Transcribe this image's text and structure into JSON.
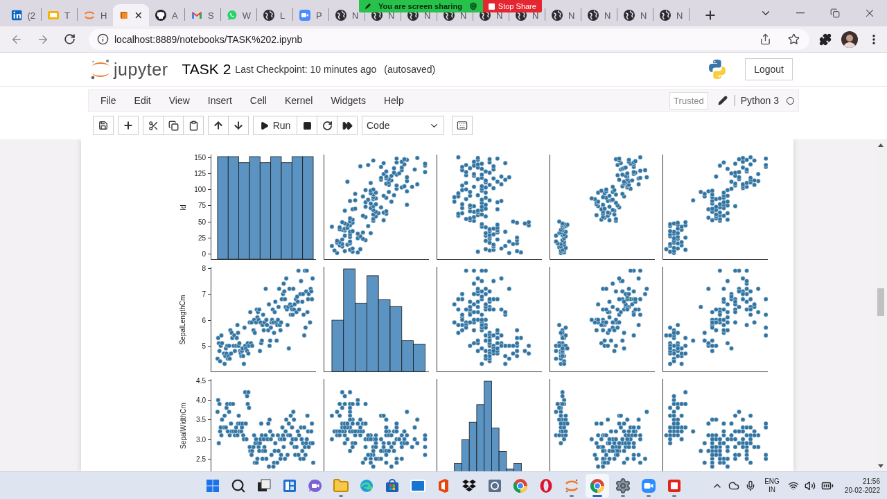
{
  "browser": {
    "tabs": [
      {
        "kind": "linkedin",
        "label": "(2",
        "selected": false
      },
      {
        "kind": "slides",
        "label": "T",
        "selected": false
      },
      {
        "kind": "ring",
        "label": "H",
        "selected": false
      },
      {
        "kind": "book",
        "selected": true
      },
      {
        "kind": "github",
        "label": "A",
        "selected": false
      },
      {
        "kind": "gmail",
        "label": "S",
        "selected": false
      },
      {
        "kind": "whatsapp",
        "label": "W",
        "selected": false
      },
      {
        "kind": "globe",
        "label": "L",
        "selected": false
      },
      {
        "kind": "zoom",
        "label": "P",
        "selected": false
      },
      {
        "kind": "globe",
        "label": "N",
        "selected": false
      },
      {
        "kind": "globe",
        "label": "N",
        "selected": false
      },
      {
        "kind": "globe",
        "label": "N",
        "selected": false
      },
      {
        "kind": "globe",
        "label": "N",
        "selected": false
      },
      {
        "kind": "globe",
        "label": "N",
        "selected": false
      },
      {
        "kind": "globe",
        "label": "N",
        "selected": false
      },
      {
        "kind": "globe",
        "label": "N",
        "selected": false
      },
      {
        "kind": "globe",
        "label": "N",
        "selected": false
      },
      {
        "kind": "globe",
        "label": "N",
        "selected": false
      },
      {
        "kind": "globe",
        "label": "N",
        "selected": false
      }
    ],
    "address": "localhost:8889/notebooks/TASK%202.ipynb"
  },
  "share_banner": {
    "message": "You are screen sharing",
    "stop_button": "Stop Share"
  },
  "notebook": {
    "logo_text": "jupyter",
    "title": "TASK 2",
    "checkpoint": "Last Checkpoint: 10 minutes ago",
    "autosave": "(autosaved)",
    "logout": "Logout",
    "menu": [
      "File",
      "Edit",
      "View",
      "Insert",
      "Cell",
      "Kernel",
      "Widgets",
      "Help"
    ],
    "trusted": "Trusted",
    "kernel": "Python 3",
    "kernel_busy": false,
    "run_button": "Run",
    "cell_type": "Code"
  },
  "pairplot": {
    "rows": [
      {
        "label": "Id",
        "ticks": [
          "150",
          "125",
          "100",
          "75",
          "50",
          "25",
          "0"
        ]
      },
      {
        "label": "SepalLengthCm",
        "ticks": [
          "8",
          "7",
          "6",
          "5"
        ]
      },
      {
        "label": "SepalWidthCm",
        "ticks": [
          "4.5",
          "4.0",
          "3.5",
          "3.0",
          "2.5"
        ]
      }
    ]
  },
  "taskbar": {
    "apps": [
      {
        "kind": "start",
        "running": false,
        "selected": false
      },
      {
        "kind": "search",
        "running": false,
        "selected": false
      },
      {
        "kind": "taskview",
        "running": false,
        "selected": false
      },
      {
        "kind": "widgets",
        "running": false,
        "selected": false
      },
      {
        "kind": "chat",
        "running": false,
        "selected": false
      },
      {
        "kind": "folder",
        "running": true,
        "selected": false
      },
      {
        "kind": "edge",
        "running": false,
        "selected": false
      },
      {
        "kind": "store",
        "running": false,
        "selected": false
      },
      {
        "kind": "mail",
        "running": false,
        "selected": false
      },
      {
        "kind": "office",
        "running": false,
        "selected": false
      },
      {
        "kind": "dropbox",
        "running": false,
        "selected": false
      },
      {
        "kind": "app",
        "running": false,
        "selected": false
      },
      {
        "kind": "chrome",
        "running": false,
        "selected": false
      },
      {
        "kind": "opera",
        "running": false,
        "selected": false
      },
      {
        "kind": "ring",
        "running": true,
        "selected": false
      },
      {
        "kind": "chrome",
        "running": true,
        "selected": true
      },
      {
        "kind": "settings",
        "running": true,
        "selected": false
      },
      {
        "kind": "zoom",
        "running": true,
        "selected": false
      },
      {
        "kind": "recorder",
        "running": true,
        "selected": false
      }
    ],
    "language": "ENG",
    "region": "IN",
    "time": "21:56",
    "date": "20-02-2022"
  }
}
